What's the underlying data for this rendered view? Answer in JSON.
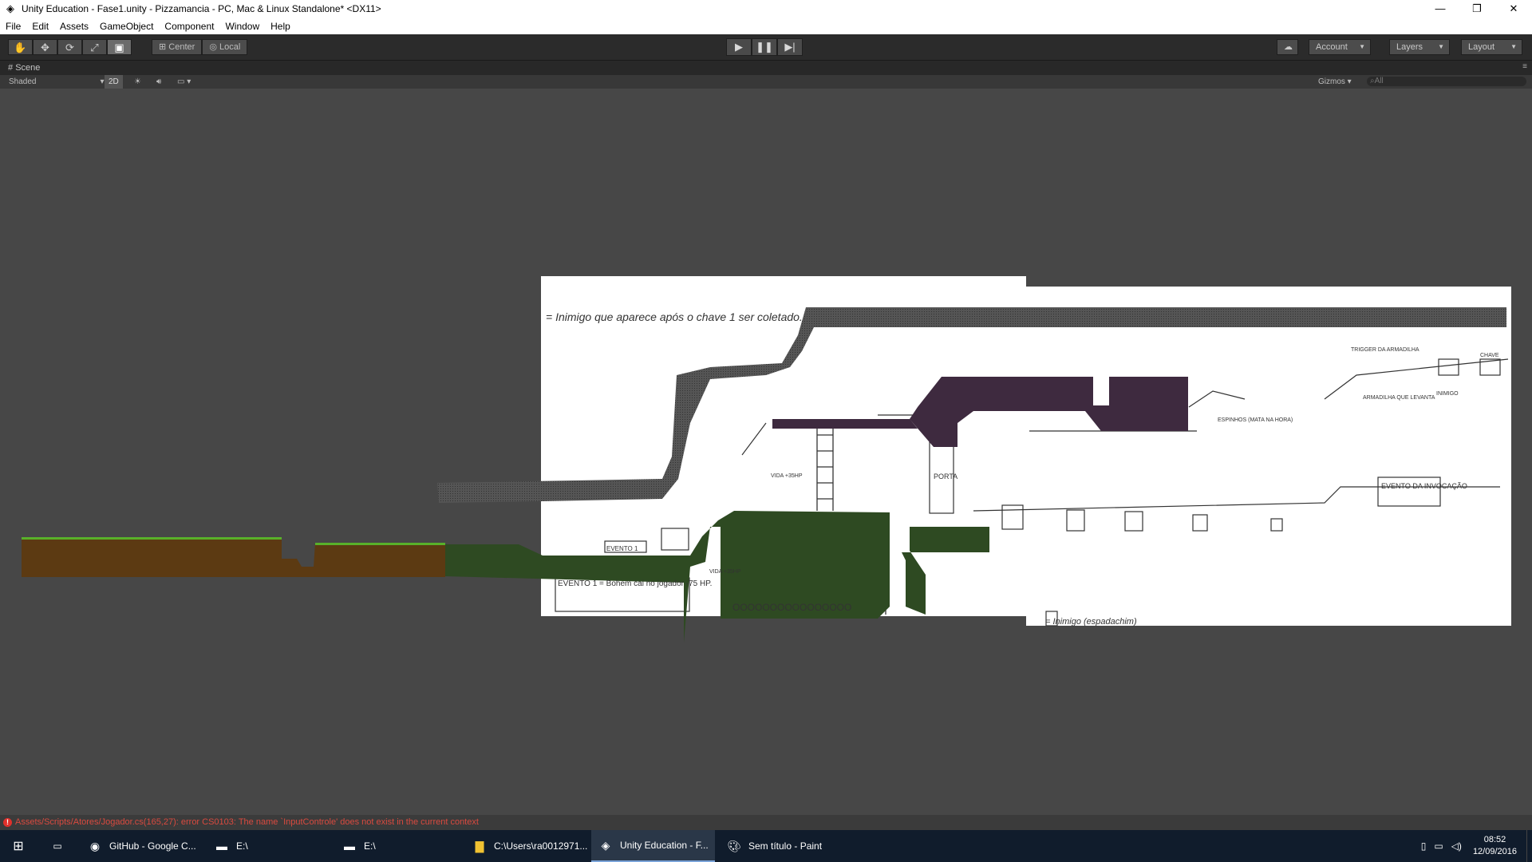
{
  "window": {
    "title": "Unity Education - Fase1.unity - Pizzamancia - PC, Mac & Linux Standalone* <DX11>",
    "controls": [
      "—",
      "❐",
      "✕"
    ]
  },
  "menu": [
    "File",
    "Edit",
    "Assets",
    "GameObject",
    "Component",
    "Window",
    "Help"
  ],
  "toolbar": {
    "pivot": "Center",
    "space": "Local",
    "account": "Account",
    "layers": "Layers",
    "layout": "Layout"
  },
  "scene": {
    "tab": "Scene",
    "shading": "Shaded",
    "mode2d": "2D",
    "gizmos": "Gizmos",
    "search_placeholder": "All"
  },
  "sketch": {
    "note_star": "= Inimigo que aparece após o chave 1 ser coletado.",
    "note_i": "= Inimigo (espadachim)",
    "evento1": "EVENTO 1 = Bohem cai no jogador -75 HP.",
    "evento1_box": "EVENTO 1",
    "evento_invocacao": "EVENTO DA INVOCAÇÃO",
    "porta": "PORTA",
    "vida1": "VIDA +35HP",
    "vida2": "VIDA +35HP",
    "trigger": "TRIGGER DA ARMADILHA",
    "armadilha": "ARMADILHA QUE LEVANTA",
    "espinhos": "ESPINHOS (MATA NA HORA)",
    "inimigo": "INIMIGO",
    "chave": "CHAVE",
    "coins": "OOOOOOOOOOOOOOOO"
  },
  "status": {
    "error": "Assets/Scripts/Atores/Jogador.cs(165,27): error CS0103: The name `InputControle' does not exist in the current context"
  },
  "taskbar": {
    "items": [
      {
        "label": "GitHub - Google C...",
        "icon": "chrome-icon"
      },
      {
        "label": "E:\\",
        "icon": "drive-icon"
      },
      {
        "label": "E:\\",
        "icon": "drive-icon"
      },
      {
        "label": "C:\\Users\\ra0012971...",
        "icon": "folder-icon"
      },
      {
        "label": "Unity Education - F...",
        "icon": "unity-icon"
      },
      {
        "label": "Sem título - Paint",
        "icon": "paint-icon"
      }
    ],
    "time": "08:52",
    "date": "12/09/2016"
  }
}
